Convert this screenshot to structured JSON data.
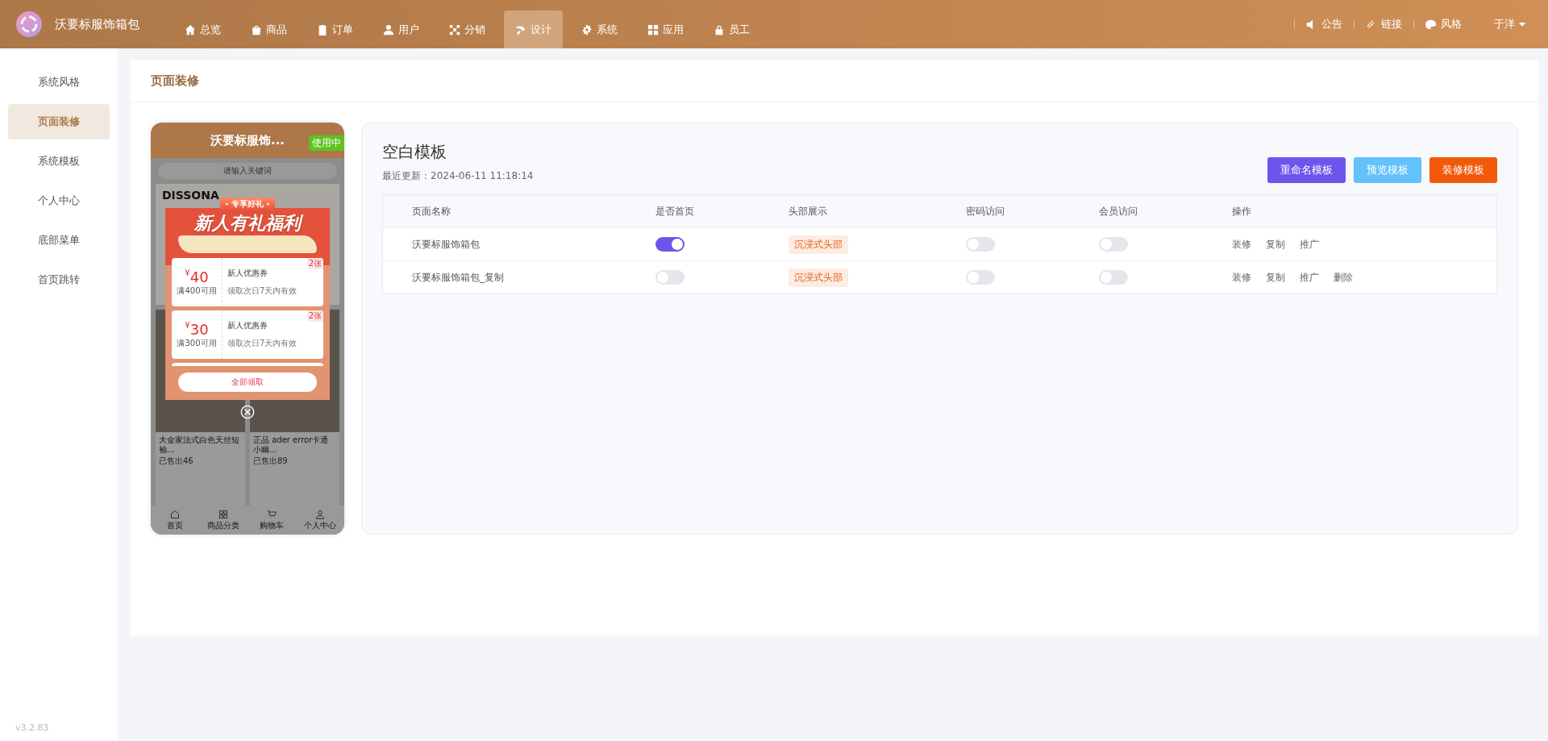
{
  "brand": {
    "name": "沃要标服饰箱包"
  },
  "nav": [
    {
      "label": "总览",
      "selected": false
    },
    {
      "label": "商品",
      "selected": false
    },
    {
      "label": "订单",
      "selected": false
    },
    {
      "label": "用户",
      "selected": false
    },
    {
      "label": "分销",
      "selected": false
    },
    {
      "label": "设计",
      "selected": true
    },
    {
      "label": "系统",
      "selected": false
    },
    {
      "label": "应用",
      "selected": false
    },
    {
      "label": "员工",
      "selected": false
    }
  ],
  "header_links": [
    "公告",
    "链接",
    "风格"
  ],
  "user": {
    "name": "于洋"
  },
  "sidebar": {
    "items": [
      {
        "label": "系统风格",
        "selected": false
      },
      {
        "label": "页面装修",
        "selected": true
      },
      {
        "label": "系统模板",
        "selected": false
      },
      {
        "label": "个人中心",
        "selected": false
      },
      {
        "label": "底部菜单",
        "selected": false
      },
      {
        "label": "首页跳转",
        "selected": false
      }
    ],
    "version": "v3.2.83"
  },
  "page_title": "页面装修",
  "preview": {
    "title": "沃要标服饰...",
    "status": "使用中",
    "search_placeholder": "请输入关键词",
    "banner_brand": "DISSONA",
    "popup": {
      "ribbon": "- 专享好礼 -",
      "headline": "新人有礼福利",
      "coupons": [
        {
          "currency": "¥",
          "amount": "40",
          "condition": "满400可用",
          "name": "新人优惠券",
          "validity": "领取次日7天内有效",
          "badge": "2张"
        },
        {
          "currency": "¥",
          "amount": "30",
          "condition": "满300可用",
          "name": "新人优惠券",
          "validity": "领取次日7天内有效",
          "badge": "2张"
        }
      ],
      "claim_button": "全部领取"
    },
    "products": [
      {
        "title": "大金家法式白色天丝短袖...",
        "sold": "已售出46"
      },
      {
        "title": "正品 ader error卡通小幽...",
        "sold": "已售出89"
      }
    ],
    "tabbar": [
      "首页",
      "商品分类",
      "购物车",
      "个人中心"
    ]
  },
  "template": {
    "name": "空白模板",
    "updated": "最近更新：2024-06-11 11:18:14",
    "buttons": [
      {
        "label": "重命名模板",
        "kind": "rename"
      },
      {
        "label": "预览模板",
        "kind": "preview"
      },
      {
        "label": "装修模板",
        "kind": "decorate"
      }
    ],
    "table": {
      "columns": [
        "页面名称",
        "是否首页",
        "头部展示",
        "密码访问",
        "会员访问",
        "操作"
      ],
      "rows": [
        {
          "name": "沃要标服饰箱包",
          "is_home": true,
          "header": "沉浸式头部",
          "password": false,
          "member": false,
          "actions": [
            "装修",
            "复制",
            "推广"
          ]
        },
        {
          "name": "沃要标服饰箱包_复制",
          "is_home": false,
          "header": "沉浸式头部",
          "password": false,
          "member": false,
          "actions": [
            "装修",
            "复制",
            "推广",
            "删除"
          ]
        }
      ]
    }
  }
}
